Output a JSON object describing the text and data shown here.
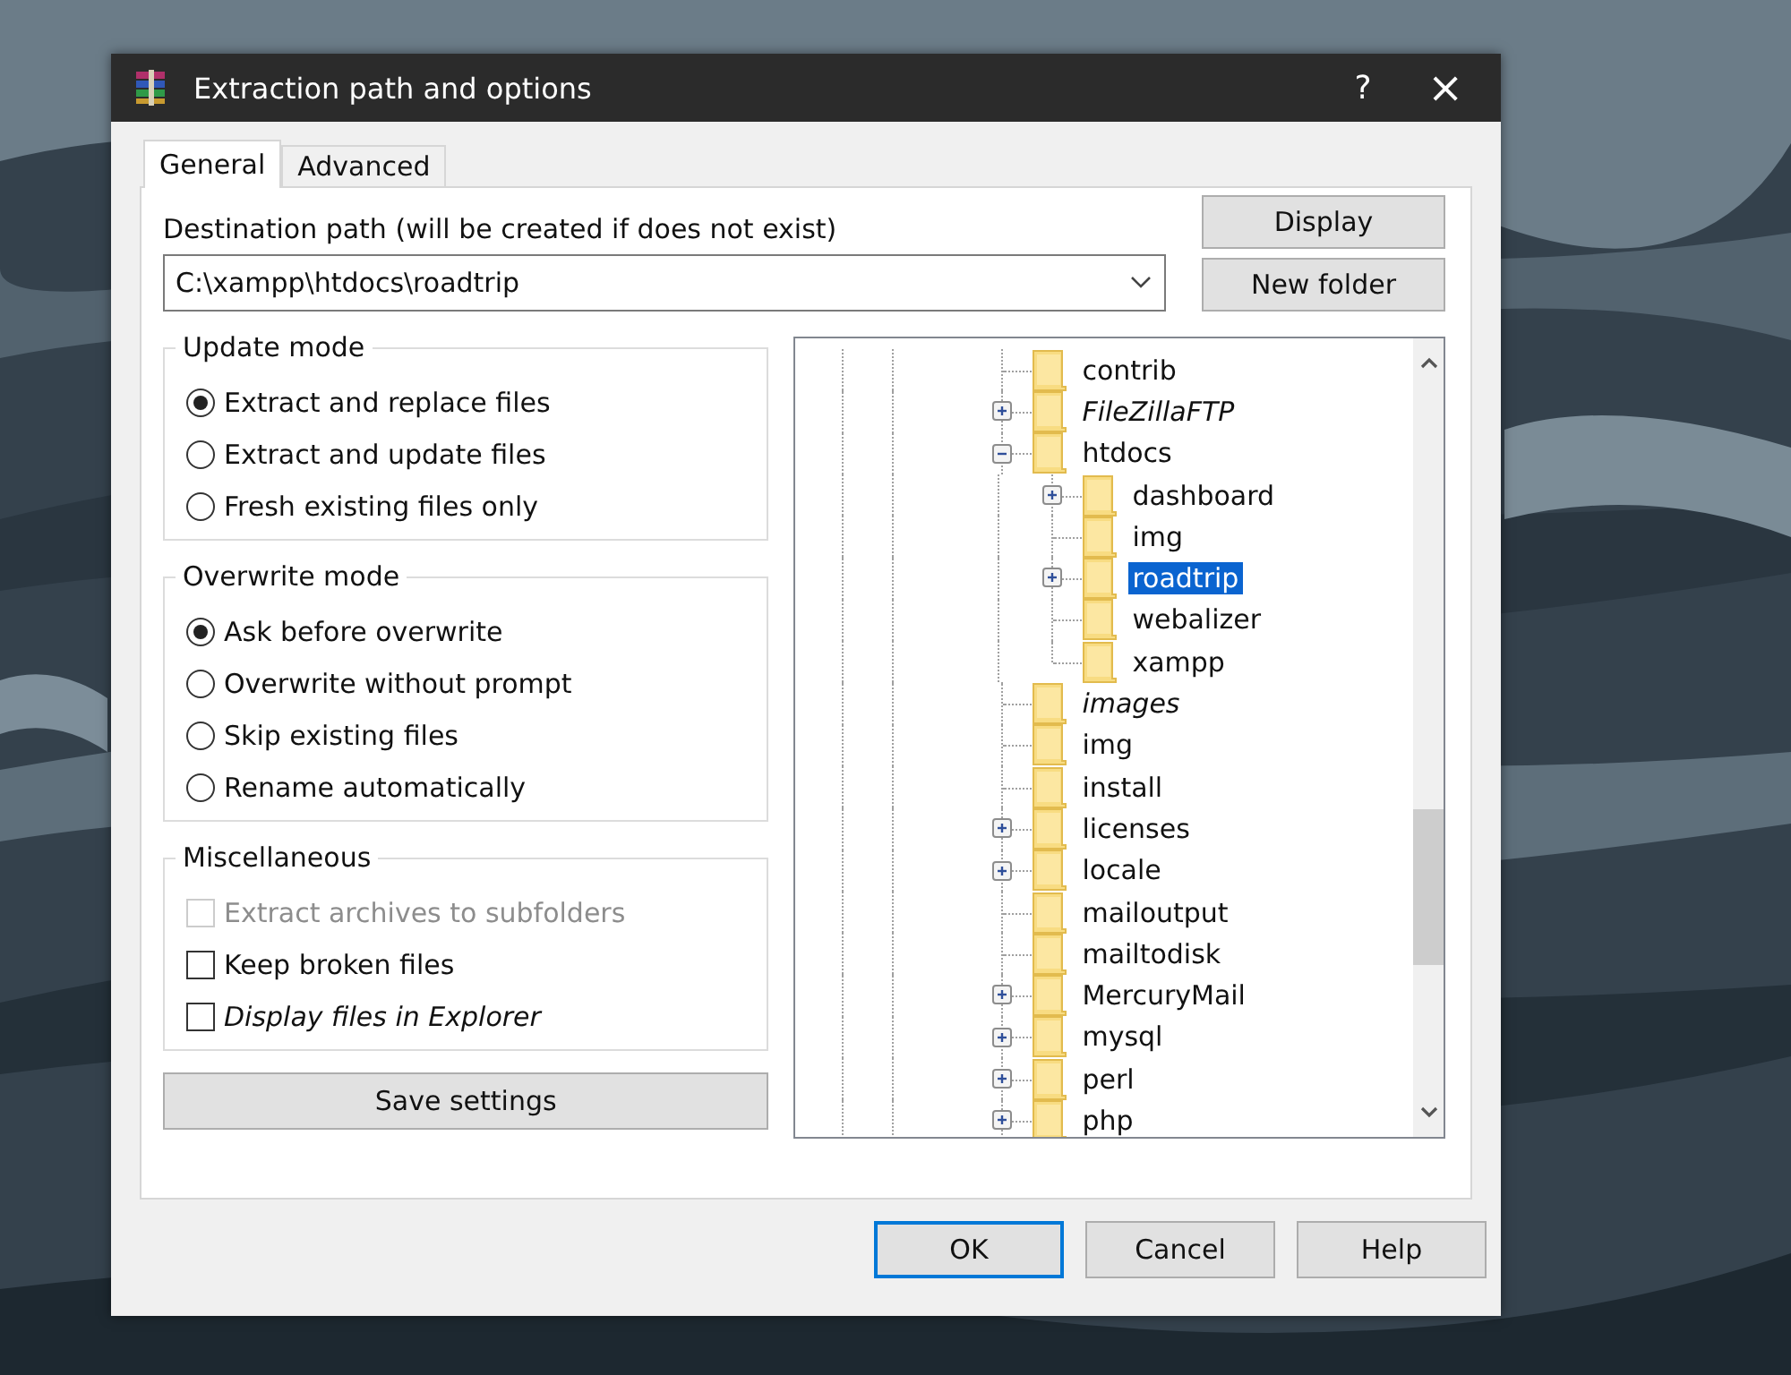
{
  "window": {
    "title": "Extraction path and options",
    "help": "?",
    "close": "×"
  },
  "tabs": [
    {
      "label": "General",
      "selected": true
    },
    {
      "label": "Advanced",
      "selected": false
    }
  ],
  "destination": {
    "label": "Destination path (will be created if does not exist)",
    "value": "C:\\xampp\\htdocs\\roadtrip"
  },
  "side_buttons": [
    "Display",
    "New folder"
  ],
  "groups": [
    {
      "title": "Update mode",
      "kind": "radio",
      "options": [
        {
          "label": "Extract and replace files",
          "selected": true
        },
        {
          "label": "Extract and update files",
          "selected": false
        },
        {
          "label": "Fresh existing files only",
          "selected": false
        }
      ]
    },
    {
      "title": "Overwrite mode",
      "kind": "radio",
      "options": [
        {
          "label": "Ask before overwrite",
          "selected": true
        },
        {
          "label": "Overwrite without prompt",
          "selected": false
        },
        {
          "label": "Skip existing files",
          "selected": false
        },
        {
          "label": "Rename automatically",
          "selected": false
        }
      ]
    },
    {
      "title": "Miscellaneous",
      "kind": "checkbox",
      "options": [
        {
          "label": "Extract archives to subfolders",
          "checked": false,
          "disabled": true,
          "italic": false
        },
        {
          "label": "Keep broken files",
          "checked": false,
          "disabled": false,
          "italic": false
        },
        {
          "label": "Display files in Explorer",
          "checked": false,
          "disabled": false,
          "italic": true
        }
      ]
    }
  ],
  "save_button": "Save settings",
  "tree": [
    {
      "label": "contrib",
      "expandable": false,
      "italic": false,
      "selected": false
    },
    {
      "label": "FileZillaFTP",
      "expandable": true,
      "expanded": false,
      "italic": true,
      "selected": false
    },
    {
      "label": "htdocs",
      "expandable": true,
      "expanded": true,
      "italic": false,
      "selected": false,
      "children": [
        {
          "label": "dashboard",
          "expandable": true,
          "expanded": false,
          "italic": false,
          "selected": false
        },
        {
          "label": "img",
          "expandable": false,
          "italic": false,
          "selected": false
        },
        {
          "label": "roadtrip",
          "expandable": true,
          "expanded": false,
          "italic": false,
          "selected": true
        },
        {
          "label": "webalizer",
          "expandable": false,
          "italic": false,
          "selected": false
        },
        {
          "label": "xampp",
          "expandable": false,
          "italic": false,
          "selected": false
        }
      ]
    },
    {
      "label": "images",
      "expandable": false,
      "italic": true,
      "selected": false
    },
    {
      "label": "img",
      "expandable": false,
      "italic": false,
      "selected": false
    },
    {
      "label": "install",
      "expandable": false,
      "italic": false,
      "selected": false
    },
    {
      "label": "licenses",
      "expandable": true,
      "expanded": false,
      "italic": false,
      "selected": false
    },
    {
      "label": "locale",
      "expandable": true,
      "expanded": false,
      "italic": false,
      "selected": false
    },
    {
      "label": "mailoutput",
      "expandable": false,
      "italic": false,
      "selected": false
    },
    {
      "label": "mailtodisk",
      "expandable": false,
      "italic": false,
      "selected": false
    },
    {
      "label": "MercuryMail",
      "expandable": true,
      "expanded": false,
      "italic": false,
      "selected": false
    },
    {
      "label": "mysql",
      "expandable": true,
      "expanded": false,
      "italic": false,
      "selected": false
    },
    {
      "label": "perl",
      "expandable": true,
      "expanded": false,
      "italic": false,
      "selected": false
    },
    {
      "label": "php",
      "expandable": true,
      "expanded": false,
      "italic": false,
      "selected": false
    }
  ],
  "buttons": [
    {
      "label": "OK",
      "default": true
    },
    {
      "label": "Cancel",
      "default": false
    },
    {
      "label": "Help",
      "default": false
    }
  ]
}
